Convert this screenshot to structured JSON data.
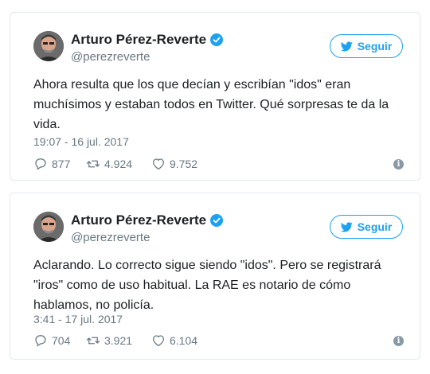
{
  "colors": {
    "accent": "#1da1f2",
    "text": "#1c2022",
    "secondary": "#697882",
    "border": "#e1e8ed"
  },
  "tweets": [
    {
      "author": {
        "name": "Arturo Pérez-Reverte",
        "handle": "@perezreverte",
        "verified": true,
        "avatar_icon": "author-avatar"
      },
      "follow_label": "Seguir",
      "text": "Ahora resulta que los que decían y escribían \"idos\" eran muchísimos y estaban todos en Twitter. Qué sorpresas te da la vida.",
      "timestamp": "19:07 - 16 jul. 2017",
      "replies": "877",
      "retweets": "4.924",
      "likes": "9.752"
    },
    {
      "author": {
        "name": "Arturo Pérez-Reverte",
        "handle": "@perezreverte",
        "verified": true,
        "avatar_icon": "author-avatar"
      },
      "follow_label": "Seguir",
      "text": "Aclarando. Lo correcto sigue siendo \"idos\". Pero se registrará \"iros\" como de uso habitual. La RAE es notario de cómo hablamos, no policía.",
      "timestamp": "3:41 - 17 jul. 2017",
      "replies": "704",
      "retweets": "3.921",
      "likes": "6.104"
    }
  ]
}
